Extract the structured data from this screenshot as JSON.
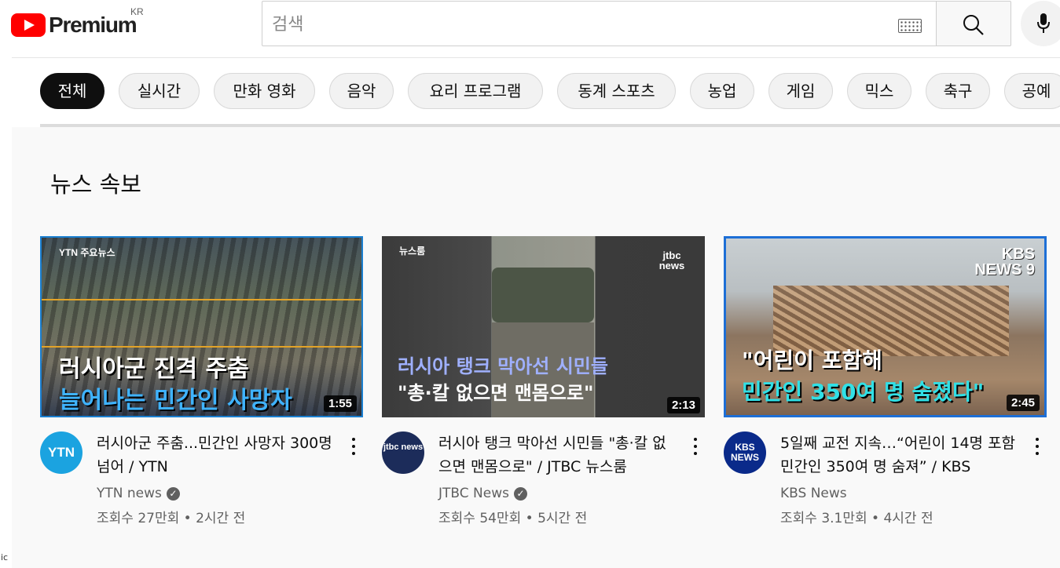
{
  "header": {
    "logo_text": "Premium",
    "region": "KR",
    "search_placeholder": "검색"
  },
  "chips": [
    {
      "label": "전체",
      "active": true
    },
    {
      "label": "실시간"
    },
    {
      "label": "만화 영화"
    },
    {
      "label": "음악"
    },
    {
      "label": "요리 프로그램"
    },
    {
      "label": "동계 스포츠"
    },
    {
      "label": "농업"
    },
    {
      "label": "게임"
    },
    {
      "label": "믹스"
    },
    {
      "label": "축구"
    },
    {
      "label": "공예"
    }
  ],
  "section": {
    "title": "뉴스 속보"
  },
  "videos": [
    {
      "thumb_tag": "YTN 주요뉴스",
      "thumb_line1": "러시아군 진격 주춤",
      "thumb_line2": "늘어나는 민간인 사망자",
      "duration": "1:55",
      "avatar_text": "YTN",
      "title": "러시아군 주춤...민간인 사망자 300명 넘어 / YTN",
      "channel": "YTN news",
      "verified": true,
      "meta": "조회수 27만회 • 2시간 전"
    },
    {
      "thumb_tag": "뉴스룸",
      "thumb_logo": "jtbc news",
      "thumb_line1": "러시아 탱크 막아선 시민들",
      "thumb_line2": "\"총·칼 없으면 맨몸으로\"",
      "duration": "2:13",
      "avatar_text": "jtbc news",
      "title": "러시아 탱크 막아선 시민들 \"총·칼 없으면 맨몸으로\" / JTBC 뉴스룸",
      "channel": "JTBC News",
      "verified": true,
      "meta": "조회수 54만회 • 5시간 전"
    },
    {
      "thumb_logo": "KBS NEWS 9",
      "thumb_line1": "\"어린이 포함해",
      "thumb_line2": "민간인 350여 명 숨졌다\"",
      "duration": "2:45",
      "avatar_text": "KBS NEWS",
      "title": "5일째 교전 지속…“어린이 14명 포함 민간인 350여 명 숨져” / KBS",
      "channel": "KBS News",
      "verified": false,
      "meta": "조회수 3.1만회 • 4시간 전"
    }
  ],
  "stray_text": "ic"
}
